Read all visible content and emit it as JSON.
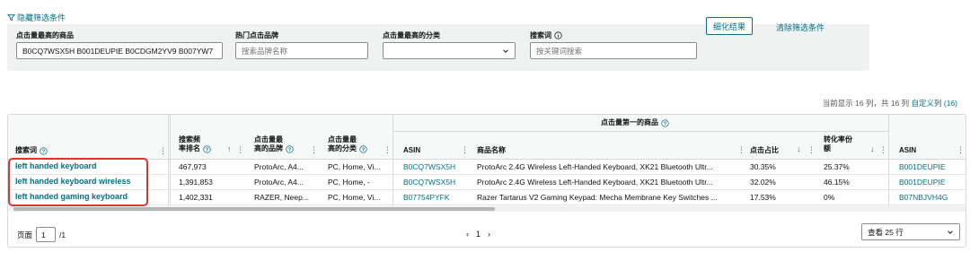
{
  "filters": {
    "toggle_label": "隐藏筛选条件",
    "top_products_label": "点击量最高的商品",
    "top_products_value": "B0CQ7WSX5H B001DEUPIE B0CDGM2YV9 B007YW7",
    "brand_label": "热门点击品牌",
    "brand_placeholder": "搜索品牌名称",
    "category_label": "点击量最高的分类",
    "category_value": "",
    "search_term_label": "搜索词",
    "search_term_placeholder": "按关键词搜索",
    "refine_button": "细化结果",
    "clear_link": "清除筛选条件"
  },
  "column_status": {
    "text": "当前显示 16 列，共 16 列",
    "customize_link": "自定义列 (16)"
  },
  "table": {
    "group_header": "点击量第一的商品",
    "headers": {
      "search_term": "搜索词",
      "frequency_line1": "搜索频",
      "frequency_line2": "率排名",
      "top_brand_line1": "点击量最",
      "top_brand_line2": "高的品牌",
      "top_category_line1": "点击量最",
      "top_category_line2": "高的分类",
      "asin": "ASIN",
      "product_name": "商品名称",
      "click_share": "点击占比",
      "conversion_line1": "转化率份",
      "conversion_line2": "额",
      "asin2": "ASIN"
    },
    "rows": [
      {
        "keyword": "left handed keyboard",
        "rank": "467,973",
        "brand": "ProtoArc, A4...",
        "category": "PC, Home, Vi...",
        "asin": "B0CQ7WSX5H",
        "product": "ProtoArc 2.4G Wireless Left-Handed Keyboard, XK21 Bluetooth Ultr...",
        "click_share": "30.35%",
        "conversion": "25.37%",
        "asin2": "B001DEUPIE"
      },
      {
        "keyword": "left handed keyboard wireless",
        "rank": "1,391,853",
        "brand": "ProtoArc, A4...",
        "category": "PC, Home, -",
        "asin": "B0CQ7WSX5H",
        "product": "ProtoArc 2.4G Wireless Left-Handed Keyboard, XK21 Bluetooth Ultr...",
        "click_share": "32.02%",
        "conversion": "46.15%",
        "asin2": "B001DEUPIE"
      },
      {
        "keyword": "left handed gaming keyboard",
        "rank": "1,402,331",
        "brand": "RAZER, Neep...",
        "category": "PC, Home, Vi...",
        "asin": "B07754PYFK",
        "product": "Razer Tartarus V2 Gaming Keypad: Mecha Membrane Key Switches ...",
        "click_share": "17.53%",
        "conversion": "0%",
        "asin2": "B07NBJVH4G"
      }
    ]
  },
  "pagination": {
    "page_label": "页面",
    "page_value": "1",
    "total_pages": "/1",
    "prev": "‹",
    "current": "1",
    "next": "›",
    "per_page": "查看 25 行"
  },
  "colors": {
    "accent": "#007185",
    "highlight": "#e0342f"
  }
}
